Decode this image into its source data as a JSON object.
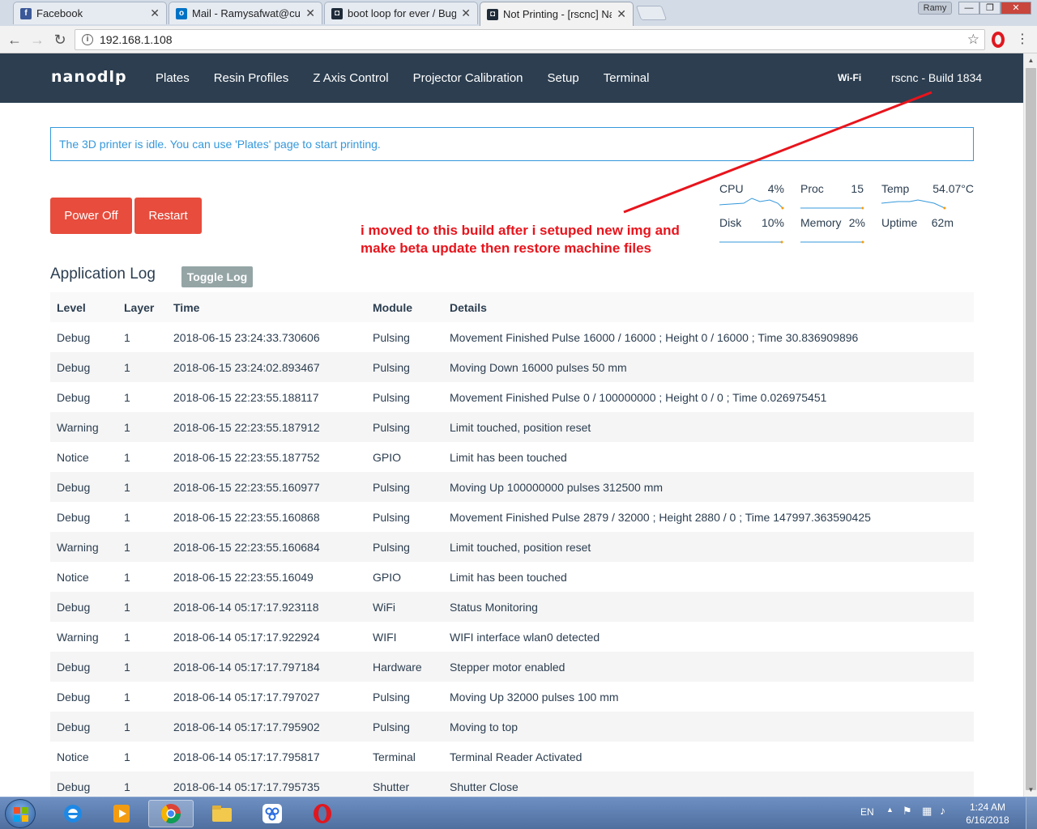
{
  "browser": {
    "tabs": [
      {
        "title": "Facebook",
        "icon": "facebook-icon",
        "color": "#3b5998"
      },
      {
        "title": "Mail - Ramysafwat@cu.ed",
        "icon": "outlook-icon",
        "color": "#0072c6"
      },
      {
        "title": "boot loop for ever / Bug",
        "icon": "nanodlp-favicon-icon",
        "color": "#1f2b38"
      },
      {
        "title": "Not Printing - [rscnc] Nan",
        "icon": "nanodlp-favicon-icon",
        "color": "#1f2b38"
      }
    ],
    "profile": "Ramy",
    "url": "192.168.1.108"
  },
  "nav": {
    "brand": "nanodlp",
    "links": [
      "Plates",
      "Resin Profiles",
      "Z Axis Control",
      "Projector Calibration",
      "Setup",
      "Terminal"
    ],
    "wifi": "Wi-Fi",
    "build": "rscnc - Build 1834"
  },
  "alert": "The 3D printer is idle. You can use 'Plates' page to start printing.",
  "buttons": {
    "power_off": "Power Off",
    "restart": "Restart"
  },
  "stats": [
    {
      "label": "CPU",
      "value": "4%"
    },
    {
      "label": "Proc",
      "value": "15"
    },
    {
      "label": "Temp",
      "value": "54.07°C"
    },
    {
      "label": "Disk",
      "value": "10%"
    },
    {
      "label": "Memory",
      "value": "2%"
    },
    {
      "label": "Uptime",
      "value": "62m"
    }
  ],
  "annotation": "i moved to this build after i setuped new img and make beta update then restore machine files",
  "log": {
    "title": "Application Log",
    "toggle": "Toggle Log",
    "columns": [
      "Level",
      "Layer",
      "Time",
      "Module",
      "Details"
    ],
    "rows": [
      [
        "Debug",
        "1",
        "2018-06-15 23:24:33.730606",
        "Pulsing",
        "Movement Finished Pulse 16000 / 16000 ; Height 0 / 16000 ; Time 30.836909896"
      ],
      [
        "Debug",
        "1",
        "2018-06-15 23:24:02.893467",
        "Pulsing",
        "Moving Down 16000 pulses 50 mm"
      ],
      [
        "Debug",
        "1",
        "2018-06-15 22:23:55.188117",
        "Pulsing",
        "Movement Finished Pulse 0 / 100000000 ; Height 0 / 0 ; Time 0.026975451"
      ],
      [
        "Warning",
        "1",
        "2018-06-15 22:23:55.187912",
        "Pulsing",
        "Limit touched, position reset"
      ],
      [
        "Notice",
        "1",
        "2018-06-15 22:23:55.187752",
        "GPIO",
        "Limit has been touched"
      ],
      [
        "Debug",
        "1",
        "2018-06-15 22:23:55.160977",
        "Pulsing",
        "Moving Up 100000000 pulses 312500 mm"
      ],
      [
        "Debug",
        "1",
        "2018-06-15 22:23:55.160868",
        "Pulsing",
        "Movement Finished Pulse 2879 / 32000 ; Height 2880 / 0 ; Time 147997.363590425"
      ],
      [
        "Warning",
        "1",
        "2018-06-15 22:23:55.160684",
        "Pulsing",
        "Limit touched, position reset"
      ],
      [
        "Notice",
        "1",
        "2018-06-15 22:23:55.16049",
        "GPIO",
        "Limit has been touched"
      ],
      [
        "Debug",
        "1",
        "2018-06-14 05:17:17.923118",
        "WiFi",
        "Status Monitoring"
      ],
      [
        "Warning",
        "1",
        "2018-06-14 05:17:17.922924",
        "WIFI",
        "WIFI interface wlan0 detected"
      ],
      [
        "Debug",
        "1",
        "2018-06-14 05:17:17.797184",
        "Hardware",
        "Stepper motor enabled"
      ],
      [
        "Debug",
        "1",
        "2018-06-14 05:17:17.797027",
        "Pulsing",
        "Moving Up 32000 pulses 100 mm"
      ],
      [
        "Debug",
        "1",
        "2018-06-14 05:17:17.795902",
        "Pulsing",
        "Moving to top"
      ],
      [
        "Notice",
        "1",
        "2018-06-14 05:17:17.795817",
        "Terminal",
        "Terminal Reader Activated"
      ],
      [
        "Debug",
        "1",
        "2018-06-14 05:17:17.795735",
        "Shutter",
        "Shutter Close"
      ]
    ]
  },
  "taskbar": {
    "lang": "EN",
    "time": "1:24 AM",
    "date": "6/16/2018",
    "apps": [
      "internet-explorer-icon",
      "media-player-icon",
      "chrome-icon",
      "file-explorer-icon",
      "baidu-icon",
      "opera-icon"
    ]
  }
}
